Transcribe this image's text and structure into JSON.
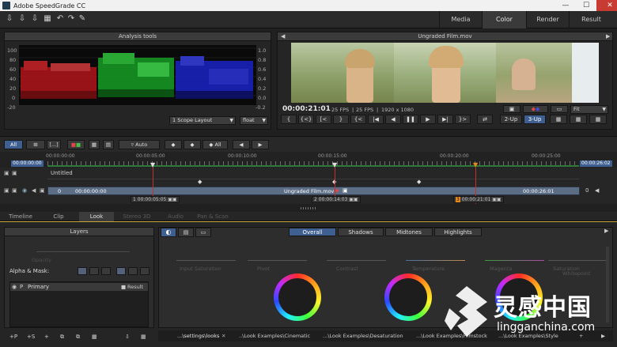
{
  "window": {
    "title": "Adobe SpeedGrade CC",
    "minimize": "—",
    "maximize": "☐",
    "close": "✕"
  },
  "nav": {
    "tabs": [
      {
        "label": "Media"
      },
      {
        "label": "Color"
      },
      {
        "label": "Render"
      },
      {
        "label": "Result"
      }
    ],
    "active": "Color"
  },
  "analysis": {
    "title": "Analysis tools",
    "left_ticks": [
      "100",
      "80",
      "60",
      "40",
      "20",
      "0",
      "-20"
    ],
    "right_ticks": [
      "1.0",
      "0.8",
      "0.6",
      "0.4",
      "0.2",
      "0.0",
      "-0.2"
    ],
    "layout_select": "1 Scope Layout",
    "mode_select": "float"
  },
  "preview": {
    "title": "Ungraded Film.mov",
    "timecode": "00:00:21:01",
    "fps1": "25 FPS",
    "fps2": "25 FPS",
    "resolution": "1920 x 1080",
    "fit_select": "Fit",
    "view_buttons": [
      "2-Up",
      "3-Up"
    ],
    "transport": [
      "{",
      "{<}",
      "[<",
      "}",
      "{<",
      "|◀",
      "◀",
      "❚❚",
      "▶",
      "▶|",
      "}>",
      "⇄"
    ]
  },
  "timeline_toolbar": {
    "all": "All",
    "auto": "Auto",
    "all_keys": "All"
  },
  "ruler": {
    "ticks": [
      "00:00:00:00",
      "00:00:05:00",
      "00:00:10:00",
      "00:00:15:00",
      "00:00:20:00",
      "00:00:25:00"
    ],
    "start": "00:00:00:00",
    "end": "00:00:26:02"
  },
  "tracks": {
    "untitled": "Untitled",
    "clip_name": "Ungraded Film.mov",
    "clip_start": "00:00:00:00",
    "clip_end": "00:00:26:01",
    "clip_index": "0",
    "clip_right_index": "0",
    "markers": [
      {
        "num": "1",
        "tc": "00:00:05:05"
      },
      {
        "num": "2",
        "tc": "00:00:14:03"
      },
      {
        "num": "3",
        "tc": "00:00:21:01"
      }
    ]
  },
  "bottom_tabs": [
    {
      "label": "Timeline"
    },
    {
      "label": "Clip"
    },
    {
      "label": "Look"
    },
    {
      "label": "Stereo 3D"
    },
    {
      "label": "Audio"
    },
    {
      "label": "Pan & Scan"
    }
  ],
  "layers": {
    "title": "Layers",
    "alpha_mask": "Alpha & Mask:",
    "primary": "Primary",
    "result": "Result",
    "ghost_label": "Opacity"
  },
  "color_tabs": [
    {
      "label": "Overall"
    },
    {
      "label": "Shadows"
    },
    {
      "label": "Midtones"
    },
    {
      "label": "Highlights"
    }
  ],
  "ghost_labels": [
    "Input Saturation",
    "Pivot",
    "Contrast",
    "Temperature",
    "Magenta",
    "Saturation",
    "Whitepoint"
  ],
  "bottom_buttons": [
    "+P",
    "+S",
    "+",
    "⧉",
    "⧉",
    "▦",
    "⇩",
    "▦"
  ],
  "looks": [
    {
      "label": "...\\settings\\looks"
    },
    {
      "label": "..\\Look Examples\\Cinematic"
    },
    {
      "label": "...\\Look Examples\\Desaturation"
    },
    {
      "label": "...\\Look Examples\\Filmstock"
    },
    {
      "label": "...\\Look Examples\\Style"
    }
  ],
  "watermark": {
    "brand": "灵感中国",
    "url": "lingganchina.com"
  },
  "colors": {
    "accent": "#3e5f8f",
    "look_border": "#caa73a",
    "marker": "#e8891b",
    "playhead": "#c23030"
  }
}
